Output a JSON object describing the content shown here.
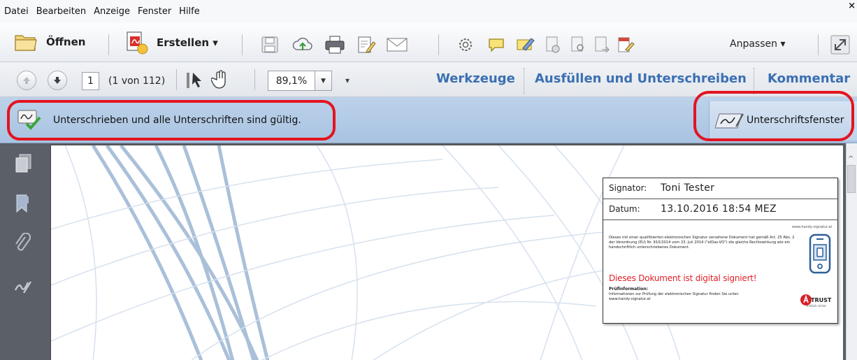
{
  "menu": [
    "Datei",
    "Bearbeiten",
    "Anzeige",
    "Fenster",
    "Hilfe"
  ],
  "menu_close": "×",
  "toolbar": {
    "open_label": "Öffnen",
    "create_label": "Erstellen ▾",
    "customize_label": "Anpassen ▾"
  },
  "nav": {
    "current_page": "1",
    "page_count": "(1 von 112)",
    "zoom": "89,1%",
    "zoom_dropdown": "▼",
    "more": "▾"
  },
  "tabs": [
    "Werkzeuge",
    "Ausfüllen und Unterschreiben",
    "Kommentar"
  ],
  "signature_bar": {
    "status": "Unterschrieben und alle Unterschriften sind gültig.",
    "panel_button": "Unterschriftsfenster"
  },
  "stamp": {
    "signator_key": "Signator:",
    "signator_value": "Toni Tester",
    "date_key": "Datum:",
    "date_value": "13.10.2016 18:54 MEZ",
    "url_top": "www.handy-signatur.at",
    "legal_text": "Dieses mit einer qualifizierten elektronischen Signatur versehene Dokument hat gemäß Art. 25 Abs. 2 der Verordnung (EU) Nr. 910/2014 vom 23. Juli 2014 (\"eIDas-VO\") die gleiche Rechtswirkung wie ein handschriftlich unterschriebenes Dokument.",
    "signed_notice": "Dieses Dokument ist digital signiert!",
    "pruef_heading": "Prüfinformation:",
    "pruef_text": "Informationen zur Prüfung der elektronischen Signatur finden Sie unter: www.handy-signatur.at",
    "trust_label": "TRUST",
    "trust_sub": "einfach sicher"
  },
  "colors": {
    "signature_bar": "#b5cde8",
    "tab_text": "#3b6fb2",
    "highlight_ring": "#e3141f",
    "signed_notice": "#e02028"
  }
}
